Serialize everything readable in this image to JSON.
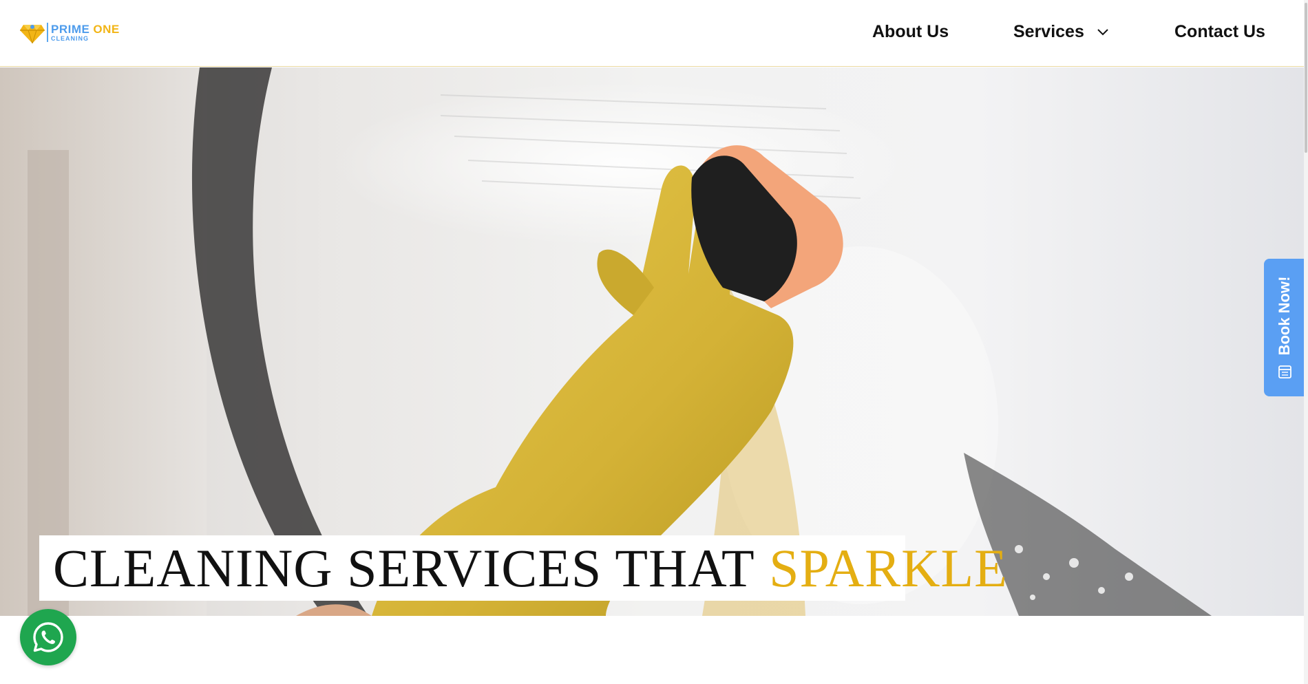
{
  "logo": {
    "word1": "PRIME",
    "word2": "ONE",
    "sub": "CLEANING"
  },
  "nav": {
    "about": "About Us",
    "services": "Services",
    "contact": "Contact Us"
  },
  "hero": {
    "headline_main": "CLEANING SERVICES THAT",
    "headline_accent": "SPARKLE"
  },
  "book_now": {
    "label": "Book Now!",
    "icon": "calendar-icon"
  },
  "whatsapp": {
    "icon": "whatsapp-icon"
  },
  "colors": {
    "accent": "#e4ae12",
    "brand_blue": "#4e9cec",
    "book_now_bg": "#5a9ff3",
    "whatsapp": "#1fa64f"
  }
}
